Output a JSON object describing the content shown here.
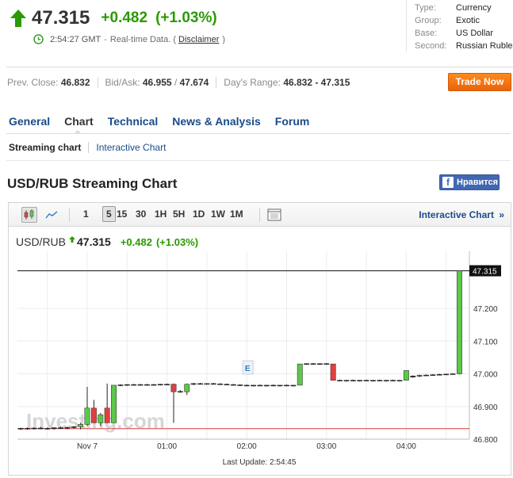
{
  "quote": {
    "last": "47.315",
    "change": "+0.482",
    "change_pct": "(+1.03%)",
    "time": "2:54:27 GMT",
    "rt_sep": "-",
    "rt_label": "Real-time Data. (",
    "disclaimer": "Disclaimer",
    "rt_close": ")",
    "direction": "up",
    "up_color": "#2a9a00"
  },
  "info": [
    {
      "k": "Type:",
      "v": "Currency"
    },
    {
      "k": "Group:",
      "v": "Exotic"
    },
    {
      "k": "Base:",
      "v": "US Dollar"
    },
    {
      "k": "Second:",
      "v": "Russian Ruble"
    }
  ],
  "stats": {
    "prev_close_label": "Prev. Close:",
    "prev_close": "46.832",
    "bid_ask_label": "Bid/Ask:",
    "bid": "46.955",
    "ask_sep": " / ",
    "ask": "47.674",
    "range_label": "Day's Range:",
    "range": "46.832 - 47.315"
  },
  "trade_button": "Trade Now",
  "tabs": [
    "General",
    "Chart",
    "Technical",
    "News & Analysis",
    "Forum"
  ],
  "active_tab": "Chart",
  "subnav": {
    "active": "Streaming chart",
    "link": "Interactive Chart"
  },
  "chart_title": "USD/RUB Streaming Chart",
  "fb": {
    "icon": "f",
    "label": "Нравится"
  },
  "toolbar": {
    "intervals": [
      "1",
      "5",
      "15",
      "30",
      "1H",
      "5H",
      "1D",
      "1W",
      "1M"
    ],
    "selected_interval": "5",
    "interactive_label": "Interactive Chart",
    "interactive_arrow": "»"
  },
  "legend": {
    "symbol": "USD/RUB",
    "price": "47.315",
    "change": "+0.482",
    "change_pct": "(+1.03%)"
  },
  "watermark": "Investing.com",
  "last_update_label": "Last Update:",
  "last_update_time": "2:54:45",
  "colors": {
    "up": "#5cc84a",
    "down": "#e04040",
    "accent": "#1a4b8a",
    "orange": "#f07a12",
    "prev_close_line": "#d93a3a"
  },
  "chart_data": {
    "type": "candlestick",
    "x_ticks": [
      "Nov 7",
      "01:00",
      "02:00",
      "03:00",
      "04:00"
    ],
    "y_ticks": [
      46.8,
      46.9,
      47.0,
      47.1,
      47.2
    ],
    "y_tick_labels": [
      "46.800",
      "46.900",
      "47.000",
      "47.100",
      "47.200"
    ],
    "ylim": [
      46.8,
      47.36
    ],
    "last_value": 47.315,
    "last_value_label": "47.315",
    "prev_close": 46.832,
    "event_marker": "E",
    "candles": [
      {
        "t": "23:10",
        "o": 46.832,
        "h": 46.835,
        "l": 46.828,
        "c": 46.833
      },
      {
        "t": "23:15",
        "o": 46.833,
        "h": 46.836,
        "l": 46.829,
        "c": 46.832
      },
      {
        "t": "23:20",
        "o": 46.832,
        "h": 46.835,
        "l": 46.829,
        "c": 46.834
      },
      {
        "t": "23:25",
        "o": 46.834,
        "h": 46.838,
        "l": 46.83,
        "c": 46.833
      },
      {
        "t": "23:30",
        "o": 46.833,
        "h": 46.836,
        "l": 46.829,
        "c": 46.832
      },
      {
        "t": "23:35",
        "o": 46.832,
        "h": 46.836,
        "l": 46.829,
        "c": 46.835
      },
      {
        "t": "23:40",
        "o": 46.835,
        "h": 46.838,
        "l": 46.831,
        "c": 46.834
      },
      {
        "t": "23:45",
        "o": 46.834,
        "h": 46.838,
        "l": 46.83,
        "c": 46.836
      },
      {
        "t": "23:50",
        "o": 46.836,
        "h": 46.84,
        "l": 46.832,
        "c": 46.838
      },
      {
        "t": "23:55",
        "o": 46.838,
        "h": 46.85,
        "l": 46.83,
        "c": 46.845
      },
      {
        "t": "00:00",
        "o": 46.845,
        "h": 46.96,
        "l": 46.84,
        "c": 46.895
      },
      {
        "t": "00:05",
        "o": 46.895,
        "h": 46.92,
        "l": 46.85,
        "c": 46.85
      },
      {
        "t": "00:10",
        "o": 46.85,
        "h": 46.88,
        "l": 46.84,
        "c": 46.875
      },
      {
        "t": "00:15",
        "o": 46.895,
        "h": 46.97,
        "l": 46.85,
        "c": 46.85
      },
      {
        "t": "00:20",
        "o": 46.85,
        "h": 46.965,
        "l": 46.85,
        "c": 46.965
      },
      {
        "t": "00:25",
        "o": 46.965,
        "h": 46.968,
        "l": 46.962,
        "c": 46.966
      },
      {
        "t": "00:30",
        "o": 46.966,
        "h": 46.968,
        "l": 46.963,
        "c": 46.967
      },
      {
        "t": "00:35",
        "o": 46.967,
        "h": 46.969,
        "l": 46.964,
        "c": 46.966
      },
      {
        "t": "00:40",
        "o": 46.966,
        "h": 46.969,
        "l": 46.964,
        "c": 46.967
      },
      {
        "t": "00:45",
        "o": 46.967,
        "h": 46.969,
        "l": 46.964,
        "c": 46.966
      },
      {
        "t": "00:50",
        "o": 46.966,
        "h": 46.969,
        "l": 46.964,
        "c": 46.967
      },
      {
        "t": "00:55",
        "o": 46.967,
        "h": 46.969,
        "l": 46.964,
        "c": 46.968
      },
      {
        "t": "01:00",
        "o": 46.968,
        "h": 46.97,
        "l": 46.965,
        "c": 46.968
      },
      {
        "t": "01:05",
        "o": 46.968,
        "h": 46.97,
        "l": 46.85,
        "c": 46.945
      },
      {
        "t": "01:10",
        "o": 46.945,
        "h": 46.95,
        "l": 46.942,
        "c": 46.946
      },
      {
        "t": "01:15",
        "o": 46.945,
        "h": 46.97,
        "l": 46.935,
        "c": 46.968
      },
      {
        "t": "01:20",
        "o": 46.968,
        "h": 46.972,
        "l": 46.965,
        "c": 46.97
      },
      {
        "t": "01:25",
        "o": 46.97,
        "h": 46.972,
        "l": 46.967,
        "c": 46.969
      },
      {
        "t": "01:30",
        "o": 46.969,
        "h": 46.971,
        "l": 46.967,
        "c": 46.97
      },
      {
        "t": "01:35",
        "o": 46.97,
        "h": 46.972,
        "l": 46.967,
        "c": 46.969
      },
      {
        "t": "01:40",
        "o": 46.969,
        "h": 46.971,
        "l": 46.966,
        "c": 46.968
      },
      {
        "t": "01:45",
        "o": 46.968,
        "h": 46.97,
        "l": 46.965,
        "c": 46.967
      },
      {
        "t": "01:50",
        "o": 46.967,
        "h": 46.969,
        "l": 46.964,
        "c": 46.966
      },
      {
        "t": "01:55",
        "o": 46.966,
        "h": 46.968,
        "l": 46.963,
        "c": 46.965
      },
      {
        "t": "02:00",
        "o": 46.965,
        "h": 46.967,
        "l": 46.962,
        "c": 46.964
      },
      {
        "t": "02:05",
        "o": 46.964,
        "h": 46.966,
        "l": 46.961,
        "c": 46.965
      },
      {
        "t": "02:10",
        "o": 46.965,
        "h": 46.967,
        "l": 46.962,
        "c": 46.964
      },
      {
        "t": "02:15",
        "o": 46.964,
        "h": 46.966,
        "l": 46.961,
        "c": 46.965
      },
      {
        "t": "02:20",
        "o": 46.965,
        "h": 46.967,
        "l": 46.962,
        "c": 46.964
      },
      {
        "t": "02:25",
        "o": 46.964,
        "h": 46.966,
        "l": 46.961,
        "c": 46.965
      },
      {
        "t": "02:30",
        "o": 46.965,
        "h": 46.967,
        "l": 46.962,
        "c": 46.964
      },
      {
        "t": "02:35",
        "o": 46.964,
        "h": 46.966,
        "l": 46.961,
        "c": 46.965
      },
      {
        "t": "02:40",
        "o": 46.965,
        "h": 47.03,
        "l": 46.965,
        "c": 47.03
      },
      {
        "t": "02:45",
        "o": 47.03,
        "h": 47.032,
        "l": 47.027,
        "c": 47.031
      },
      {
        "t": "02:50",
        "o": 47.031,
        "h": 47.033,
        "l": 47.028,
        "c": 47.03
      },
      {
        "t": "02:55",
        "o": 47.03,
        "h": 47.032,
        "l": 47.027,
        "c": 47.031
      },
      {
        "t": "03:00",
        "o": 47.031,
        "h": 47.033,
        "l": 47.028,
        "c": 47.03
      },
      {
        "t": "03:05",
        "o": 47.03,
        "h": 47.03,
        "l": 46.98,
        "c": 46.98
      },
      {
        "t": "03:10",
        "o": 46.98,
        "h": 46.982,
        "l": 46.977,
        "c": 46.979
      },
      {
        "t": "03:15",
        "o": 46.979,
        "h": 46.981,
        "l": 46.976,
        "c": 46.98
      },
      {
        "t": "03:20",
        "o": 46.98,
        "h": 46.982,
        "l": 46.977,
        "c": 46.979
      },
      {
        "t": "03:25",
        "o": 46.979,
        "h": 46.981,
        "l": 46.976,
        "c": 46.98
      },
      {
        "t": "03:30",
        "o": 46.98,
        "h": 46.982,
        "l": 46.977,
        "c": 46.979
      },
      {
        "t": "03:35",
        "o": 46.979,
        "h": 46.981,
        "l": 46.976,
        "c": 46.98
      },
      {
        "t": "03:40",
        "o": 46.98,
        "h": 46.982,
        "l": 46.977,
        "c": 46.979
      },
      {
        "t": "03:45",
        "o": 46.979,
        "h": 46.981,
        "l": 46.976,
        "c": 46.98
      },
      {
        "t": "03:50",
        "o": 46.98,
        "h": 46.982,
        "l": 46.977,
        "c": 46.979
      },
      {
        "t": "03:55",
        "o": 46.979,
        "h": 46.981,
        "l": 46.976,
        "c": 46.98
      },
      {
        "t": "04:00",
        "o": 46.98,
        "h": 47.01,
        "l": 46.98,
        "c": 47.01
      },
      {
        "t": "04:05",
        "o": 46.99,
        "h": 46.995,
        "l": 46.988,
        "c": 46.993
      },
      {
        "t": "04:10",
        "o": 46.993,
        "h": 46.997,
        "l": 46.99,
        "c": 46.995
      },
      {
        "t": "04:15",
        "o": 46.995,
        "h": 46.998,
        "l": 46.993,
        "c": 46.996
      },
      {
        "t": "04:20",
        "o": 46.996,
        "h": 46.999,
        "l": 46.994,
        "c": 46.997
      },
      {
        "t": "04:25",
        "o": 46.997,
        "h": 47.0,
        "l": 46.995,
        "c": 46.998
      },
      {
        "t": "04:30",
        "o": 46.998,
        "h": 47.0,
        "l": 46.996,
        "c": 46.999
      },
      {
        "t": "04:35",
        "o": 46.999,
        "h": 47.001,
        "l": 46.997,
        "c": 47.0
      },
      {
        "t": "04:40",
        "o": 47.0,
        "h": 47.315,
        "l": 46.998,
        "c": 47.315
      }
    ]
  }
}
